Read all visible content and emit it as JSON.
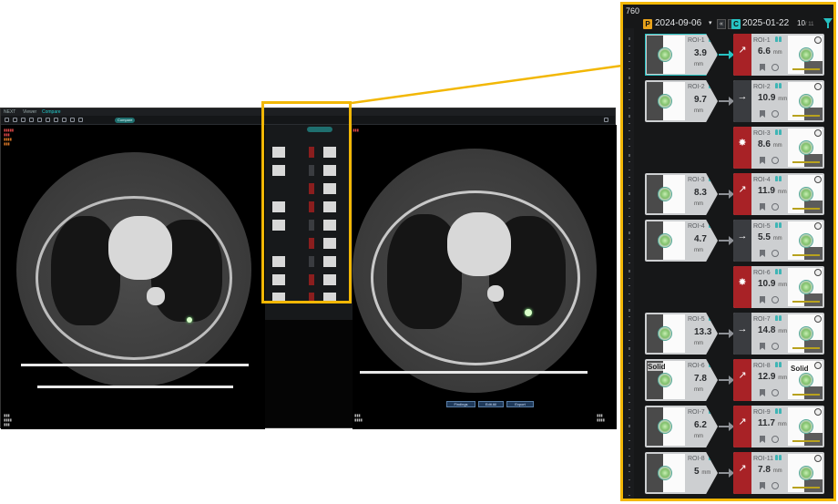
{
  "colors": {
    "highlight": "#f2b705",
    "accent": "#27c3c3",
    "new_flag": "#a82226",
    "prior_badge": "#e8a21b",
    "current_badge": "#27c3c3"
  },
  "viewer": {
    "tab_title": "NEXT",
    "tab_viewer": "Viewer",
    "tab_compare": "Compare"
  },
  "bottom_buttons": [
    "Findings",
    "Edit All",
    "Export"
  ],
  "header": {
    "series_number": "760",
    "prior_badge": "P",
    "prior_date": "2024-09-06",
    "current_badge": "C",
    "current_date": "2025-01-22",
    "page_indicator": "10",
    "page_total": "/ 11",
    "nav_first_icon": "double-chevron-left-icon",
    "nav_prev_icon": "chevron-left-icon",
    "filter_icon": "filter-funnel-icon"
  },
  "unit": "mm",
  "solid_label": "Solid",
  "rows": [
    {
      "prior": {
        "label": "ROI-1",
        "size": "3.9"
      },
      "current": {
        "label": "ROI-1",
        "size": "6.6",
        "status": "growth"
      },
      "selected": true
    },
    {
      "prior": {
        "label": "ROI-2",
        "size": "9.7"
      },
      "current": {
        "label": "ROI-2",
        "size": "10.9",
        "status": "stable"
      }
    },
    {
      "prior": null,
      "current": {
        "label": "ROI-3",
        "size": "8.6",
        "status": "new"
      }
    },
    {
      "prior": {
        "label": "ROI-3",
        "size": "8.3"
      },
      "current": {
        "label": "ROI-4",
        "size": "11.9",
        "status": "growth"
      }
    },
    {
      "prior": {
        "label": "ROI-4",
        "size": "4.7"
      },
      "current": {
        "label": "ROI-5",
        "size": "5.5",
        "status": "stable"
      }
    },
    {
      "prior": null,
      "current": {
        "label": "ROI-6",
        "size": "10.9",
        "status": "new"
      }
    },
    {
      "prior": {
        "label": "ROI-5",
        "size": "13.3"
      },
      "current": {
        "label": "ROI-7",
        "size": "14.8",
        "status": "stable"
      }
    },
    {
      "prior": {
        "label": "ROI-6",
        "size": "7.8",
        "solid": true
      },
      "current": {
        "label": "ROI-8",
        "size": "12.9",
        "status": "growth",
        "solid": true
      }
    },
    {
      "prior": {
        "label": "ROI-7",
        "size": "6.2"
      },
      "current": {
        "label": "ROI-9",
        "size": "11.7",
        "status": "growth"
      }
    },
    {
      "prior": {
        "label": "ROI-8",
        "size": "5"
      },
      "current": {
        "label": "ROI-11",
        "size": "7.8",
        "status": "growth"
      }
    }
  ]
}
